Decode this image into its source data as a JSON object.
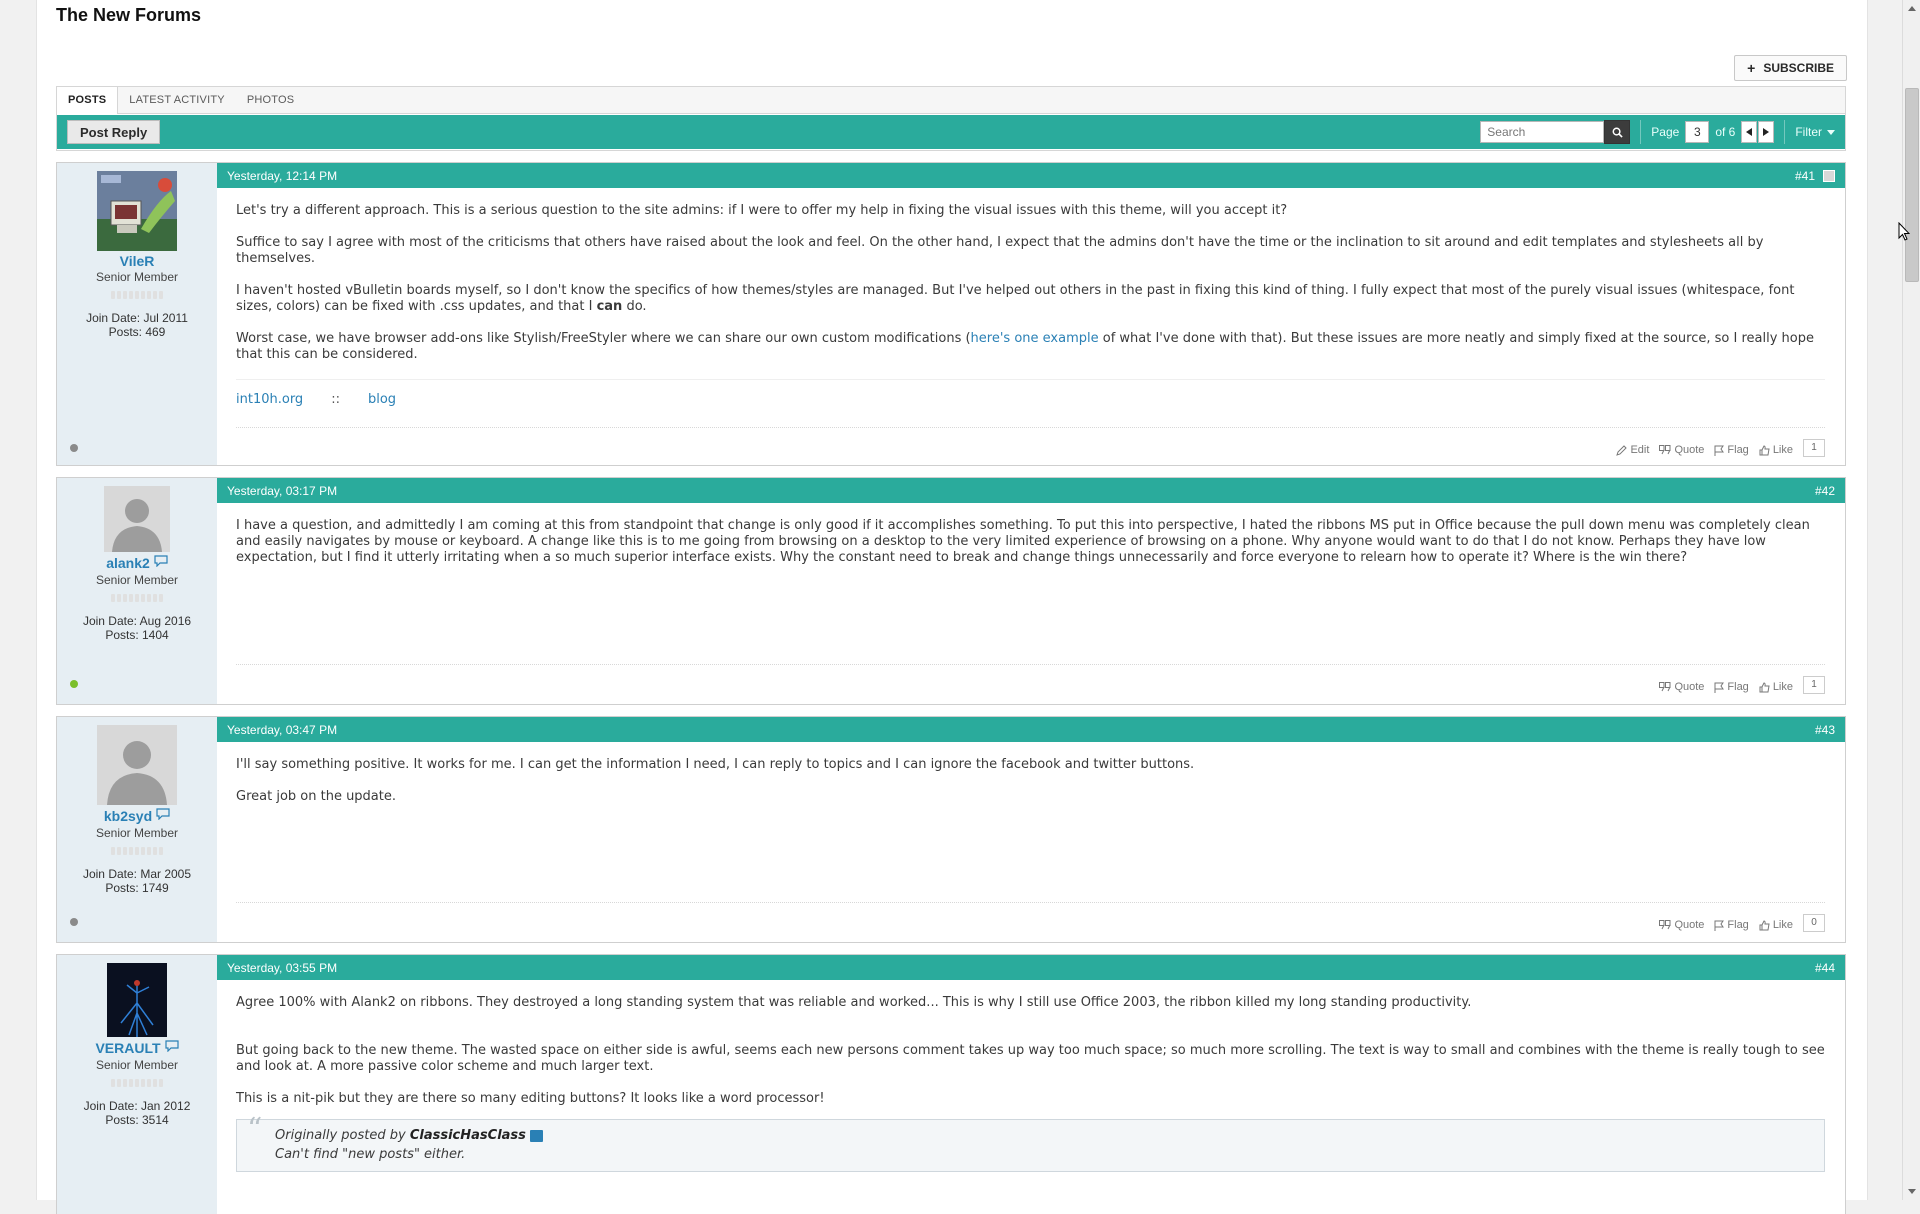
{
  "forum": {
    "title": "The New Forums",
    "subscribe_label": "SUBSCRIBE"
  },
  "tabs": [
    {
      "label": "POSTS"
    },
    {
      "label": "LATEST ACTIVITY"
    },
    {
      "label": "PHOTOS"
    }
  ],
  "toolbar": {
    "post_reply_label": "Post Reply",
    "search_placeholder": "Search",
    "page_label": "Page",
    "current_page": "3",
    "of_label": "of 6",
    "filter_label": "Filter"
  },
  "posts": [
    {
      "number": "#41",
      "time": "Yesterday, 12:14 PM",
      "user": {
        "name": "VileR",
        "title": "Senior Member",
        "join": "Join Date: Jul 2011",
        "posts": "Posts: 469",
        "status": "offline"
      },
      "paragraphs": [
        "Let's try a different approach. This is a serious question to the site admins: if I were to offer my help in fixing the visual issues with this theme, will you accept it?",
        "Suffice to say I agree with most of the criticisms that others have raised about the look and feel. On the other hand, I expect that the admins don't have the time or the inclination to sit around and edit templates and stylesheets all by themselves."
      ],
      "p3": {
        "before": "I haven't hosted vBulletin boards myself, so I don't know the specifics of how themes/styles are managed. But I've helped out others in the past in fixing this kind of thing. I fully expect that most of the purely visual issues (whitespace, font sizes, colors) can be fixed with .css updates, and that I ",
        "bold": "can",
        "after": " do."
      },
      "p4": {
        "before": "Worst case, we have browser add-ons like Stylish/FreeStyler where we can share our own custom modifications (",
        "link": "here's one example",
        "after": " of what I've done with that). But these issues are more neatly and simply fixed at the source, so I really hope that this can be considered."
      },
      "signature": {
        "link1": "int10h.org",
        "sep": "::",
        "link2": "blog"
      },
      "actions": {
        "edit": "Edit",
        "quote": "Quote",
        "flag": "Flag",
        "like": "Like",
        "likes": "1"
      }
    },
    {
      "number": "#42",
      "time": "Yesterday, 03:17 PM",
      "user": {
        "name": "alank2",
        "title": "Senior Member",
        "join": "Join Date: Aug 2016",
        "posts": "Posts: 1404",
        "status": "online"
      },
      "text": "I have a question, and admittedly I am coming at this from standpoint that change is only good if it accomplishes something. To put this into perspective, I hated the ribbons MS put in Office because the pull down menu was completely clean and easily navigates by mouse or keyboard. A change like this is to me going from browsing on a desktop to the very limited experience of browsing on a phone. Why anyone would want to do that I do not know. Perhaps they have low expectation, but I find it utterly irritating when a so much superior interface exists. Why the constant need to break and change things unnecessarily and force everyone to relearn how to operate it? Where is the win there?",
      "actions": {
        "quote": "Quote",
        "flag": "Flag",
        "like": "Like",
        "likes": "1"
      }
    },
    {
      "number": "#43",
      "time": "Yesterday, 03:47 PM",
      "user": {
        "name": "kb2syd",
        "title": "Senior Member",
        "join": "Join Date: Mar 2005",
        "posts": "Posts: 1749",
        "status": "offline"
      },
      "paragraphs": [
        "I'll say something positive. It works for me. I can get the information I need, I can reply to topics and I can ignore the facebook and twitter buttons.",
        "Great job on the update."
      ],
      "actions": {
        "quote": "Quote",
        "flag": "Flag",
        "like": "Like",
        "likes": "0"
      }
    },
    {
      "number": "#44",
      "time": "Yesterday, 03:55 PM",
      "user": {
        "name": "VERAULT",
        "title": "Senior Member",
        "join": "Join Date: Jan 2012",
        "posts": "Posts: 3514"
      },
      "paragraphs": [
        "Agree 100% with Alank2 on ribbons. They destroyed a long standing system that was reliable and worked... This is why I still use Office 2003, the ribbon killed my long standing productivity.",
        "But going back to the new theme. The wasted space on either side is awful, seems each new persons comment takes up way too much space; so much more scrolling. The text is way to small and combines with the theme is really tough to see and look at. A more passive color scheme and much larger text.",
        "This is a nit-pik but they are there so many editing buttons? It looks like a word processor!"
      ],
      "quote": {
        "prefix": "Originally posted by",
        "author": "ClassicHasClass",
        "text": "Can't find \"new posts\" either."
      }
    }
  ],
  "colors": {
    "accent": "#2aab9c",
    "link": "#2a80b5",
    "sidebar": "#e6eef3",
    "online": "#7bbf2a",
    "offline": "#8a8a8a"
  }
}
